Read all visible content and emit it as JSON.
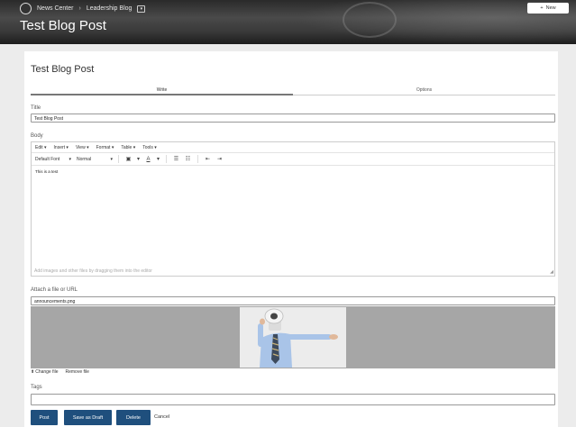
{
  "header": {
    "breadcrumb": [
      "News Center",
      "Leadership Blog"
    ],
    "title": "Test Blog Post",
    "new_button": "New"
  },
  "card": {
    "title": "Test Blog Post",
    "tabs": [
      {
        "label": "Write",
        "active": true
      },
      {
        "label": "Options",
        "active": false
      }
    ]
  },
  "form": {
    "title_label": "Title",
    "title_value": "Test Blog Post",
    "body_label": "Body",
    "editor": {
      "menus": [
        "Edit",
        "Insert",
        "View",
        "Format",
        "Table",
        "Tools"
      ],
      "font": "Default Font",
      "size": "Normal",
      "content": "This is a test",
      "hint": "Add images and other files by dragging them into the editor"
    },
    "attach_label": "Attach a file or URL",
    "attach_value": "announcements.png",
    "change_file": "Change file",
    "remove_file": "Remove file",
    "tags_label": "Tags",
    "tags_value": ""
  },
  "actions": {
    "post": "Post",
    "save_draft": "Save as Draft",
    "delete": "Delete",
    "cancel": "Cancel"
  },
  "colors": {
    "primary": "#1f4f7d",
    "background": "#ececec",
    "attach_bg": "#a6a6a6"
  }
}
